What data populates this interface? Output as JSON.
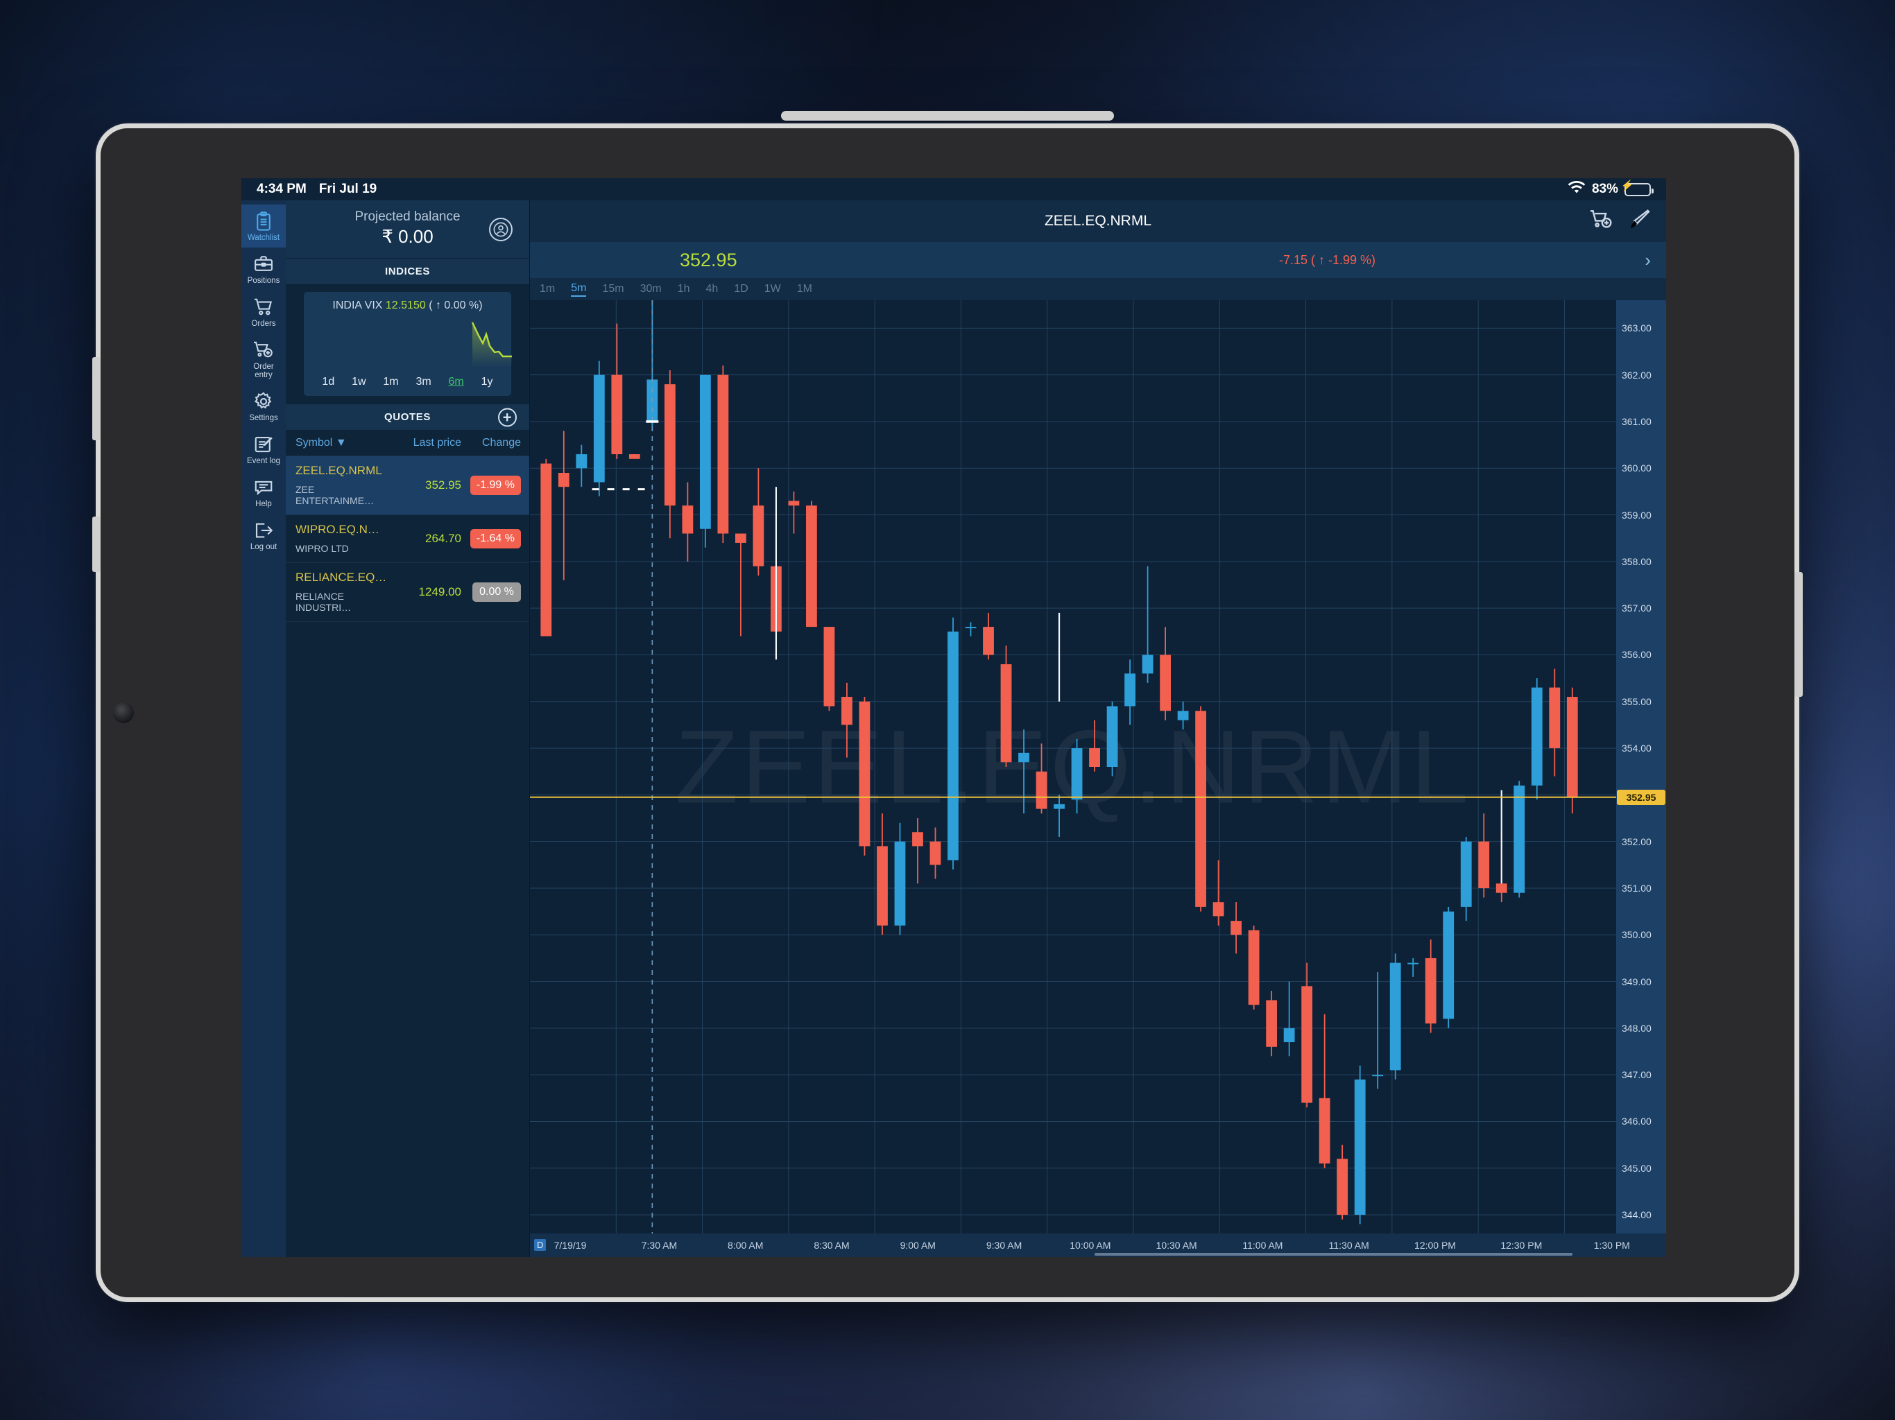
{
  "status_bar": {
    "time": "4:34 PM",
    "date": "Fri Jul 19",
    "battery_percent": "83%",
    "wifi_icon": "wifi-icon",
    "battery_icon": "battery-charging-icon"
  },
  "nav_rail": {
    "items": [
      {
        "label": "Watchlist",
        "icon": "clipboard-icon",
        "active": true
      },
      {
        "label": "Positions",
        "icon": "briefcase-icon",
        "active": false
      },
      {
        "label": "Orders",
        "icon": "cart-icon",
        "active": false
      },
      {
        "label": "Order\nentry",
        "icon": "cart-plus-icon",
        "active": false
      },
      {
        "label": "Settings",
        "icon": "gear-icon",
        "active": false
      },
      {
        "label": "Event log",
        "icon": "note-pencil-icon",
        "active": false
      },
      {
        "label": "Help",
        "icon": "chat-icon",
        "active": false
      },
      {
        "label": "Log out",
        "icon": "logout-icon",
        "active": false
      }
    ]
  },
  "watch_panel": {
    "balance": {
      "label": "Projected balance",
      "value": "₹ 0.00",
      "avatar_icon": "user-circle-icon"
    },
    "indices": {
      "header": "INDICES",
      "name": "INDIA VIX",
      "value": "12.5150",
      "change": "( ↑ 0.00 %)",
      "ranges": [
        "1d",
        "1w",
        "1m",
        "3m",
        "6m",
        "1y"
      ],
      "selected_range": "6m",
      "spark_color": "#b9dd3a"
    },
    "quotes": {
      "header": "QUOTES",
      "add_icon": "plus-circle-icon",
      "columns": {
        "symbol": "Symbol",
        "sort_icon": "▼",
        "last_price": "Last price",
        "change": "Change"
      },
      "rows": [
        {
          "symbol": "ZEEL.EQ.NRML",
          "name": "ZEE ENTERTAINME…",
          "last": "352.95",
          "change": "-1.99 %",
          "change_kind": "neg",
          "selected": true
        },
        {
          "symbol": "WIPRO.EQ.N…",
          "name": "WIPRO LTD",
          "last": "264.70",
          "change": "-1.64 %",
          "change_kind": "neg",
          "selected": false
        },
        {
          "symbol": "RELIANCE.EQ…",
          "name": "RELIANCE INDUSTRI…",
          "last": "1249.00",
          "change": "0.00 %",
          "change_kind": "flat",
          "selected": false
        }
      ]
    }
  },
  "chart_panel": {
    "title": "ZEEL.EQ.NRML",
    "icons": {
      "cart_plus": "cart-plus-icon",
      "brush": "brush-icon",
      "expand_chevron": "›"
    },
    "last_price": "352.95",
    "delta": "-7.15 ( ↑ -1.99 %)",
    "timeframes": [
      "1m",
      "5m",
      "15m",
      "30m",
      "1h",
      "4h",
      "1D",
      "1W",
      "1M"
    ],
    "selected_timeframe": "5m",
    "watermark": "ZEEL.EQ.NRML",
    "date_badge": "D",
    "date_label": "7/19/19",
    "colors": {
      "up": "#2e9fd8",
      "down": "#f2604f",
      "price_line": "#f0c13b",
      "crosshair": "#6f9bbd"
    }
  },
  "chart_data": {
    "type": "candlestick",
    "title": "ZEEL.EQ.NRML",
    "xlabel": "",
    "ylabel": "",
    "ylim": [
      343.6,
      363.6
    ],
    "y_ticks": [
      363.0,
      362.0,
      361.0,
      360.0,
      359.0,
      358.0,
      357.0,
      356.0,
      355.0,
      354.0,
      352.0,
      351.0,
      350.0,
      349.0,
      348.0,
      347.0,
      346.0,
      345.0,
      344.0
    ],
    "current_price": 352.95,
    "current_price_label": "352.95",
    "x_ticks": [
      "7/19/19",
      "7:30 AM",
      "8:00 AM",
      "8:30 AM",
      "9:00 AM",
      "9:30 AM",
      "10:00 AM",
      "10:30 AM",
      "11:00 AM",
      "11:30 AM",
      "12:00 PM",
      "12:30 PM",
      "1:30 PM"
    ],
    "grid": true,
    "candles": [
      {
        "o": 360.1,
        "h": 360.2,
        "l": 356.4,
        "c": 356.4
      },
      {
        "o": 359.9,
        "h": 360.8,
        "l": 357.6,
        "c": 359.6
      },
      {
        "o": 360.0,
        "h": 360.5,
        "l": 359.6,
        "c": 360.3
      },
      {
        "o": 359.7,
        "h": 362.3,
        "l": 359.4,
        "c": 362.0
      },
      {
        "o": 362.0,
        "h": 363.1,
        "l": 360.2,
        "c": 360.3
      },
      {
        "o": 360.3,
        "h": 360.3,
        "l": 360.2,
        "c": 360.2
      },
      {
        "o": 361.0,
        "h": 363.8,
        "l": 360.8,
        "c": 361.9
      },
      {
        "o": 361.8,
        "h": 362.1,
        "l": 358.5,
        "c": 359.2
      },
      {
        "o": 359.2,
        "h": 359.7,
        "l": 358.0,
        "c": 358.6
      },
      {
        "o": 358.7,
        "h": 362.0,
        "l": 358.3,
        "c": 362.0
      },
      {
        "o": 362.0,
        "h": 362.2,
        "l": 358.4,
        "c": 358.6
      },
      {
        "o": 358.6,
        "h": 358.6,
        "l": 356.4,
        "c": 358.4
      },
      {
        "o": 359.2,
        "h": 360.0,
        "l": 357.7,
        "c": 357.9
      },
      {
        "o": 357.9,
        "h": 359.5,
        "l": 356.4,
        "c": 356.5
      },
      {
        "o": 359.3,
        "h": 359.5,
        "l": 358.6,
        "c": 359.2
      },
      {
        "o": 359.2,
        "h": 359.3,
        "l": 356.9,
        "c": 356.6
      },
      {
        "o": 356.6,
        "h": 356.6,
        "l": 354.8,
        "c": 354.9
      },
      {
        "o": 355.1,
        "h": 355.4,
        "l": 353.8,
        "c": 354.5
      },
      {
        "o": 355.0,
        "h": 355.1,
        "l": 351.7,
        "c": 351.9
      },
      {
        "o": 351.9,
        "h": 352.6,
        "l": 350.0,
        "c": 350.2
      },
      {
        "o": 350.2,
        "h": 352.4,
        "l": 350.0,
        "c": 352.0
      },
      {
        "o": 352.2,
        "h": 352.5,
        "l": 351.1,
        "c": 351.9
      },
      {
        "o": 352.0,
        "h": 352.3,
        "l": 351.2,
        "c": 351.5
      },
      {
        "o": 351.6,
        "h": 356.8,
        "l": 351.4,
        "c": 356.5
      },
      {
        "o": 356.6,
        "h": 356.7,
        "l": 356.4,
        "c": 356.6
      },
      {
        "o": 356.6,
        "h": 356.9,
        "l": 355.9,
        "c": 356.0
      },
      {
        "o": 355.8,
        "h": 356.2,
        "l": 353.6,
        "c": 353.7
      },
      {
        "o": 353.7,
        "h": 354.4,
        "l": 352.6,
        "c": 353.9
      },
      {
        "o": 353.5,
        "h": 354.1,
        "l": 352.6,
        "c": 352.7
      },
      {
        "o": 352.7,
        "h": 353.0,
        "l": 352.1,
        "c": 352.8
      },
      {
        "o": 352.9,
        "h": 354.2,
        "l": 352.6,
        "c": 354.0
      },
      {
        "o": 354.0,
        "h": 354.6,
        "l": 353.5,
        "c": 353.6
      },
      {
        "o": 353.6,
        "h": 355.0,
        "l": 353.4,
        "c": 354.9
      },
      {
        "o": 354.9,
        "h": 355.9,
        "l": 354.5,
        "c": 355.6
      },
      {
        "o": 355.6,
        "h": 357.9,
        "l": 355.4,
        "c": 356.0
      },
      {
        "o": 356.0,
        "h": 356.6,
        "l": 354.6,
        "c": 354.8
      },
      {
        "o": 354.6,
        "h": 355.0,
        "l": 354.4,
        "c": 354.8
      },
      {
        "o": 354.8,
        "h": 354.9,
        "l": 350.5,
        "c": 350.6
      },
      {
        "o": 350.7,
        "h": 351.6,
        "l": 350.2,
        "c": 350.4
      },
      {
        "o": 350.3,
        "h": 350.7,
        "l": 349.6,
        "c": 350.0
      },
      {
        "o": 350.1,
        "h": 350.2,
        "l": 348.4,
        "c": 348.5
      },
      {
        "o": 348.6,
        "h": 348.8,
        "l": 347.4,
        "c": 347.6
      },
      {
        "o": 347.7,
        "h": 349.0,
        "l": 347.4,
        "c": 348.0
      },
      {
        "o": 348.9,
        "h": 349.4,
        "l": 346.3,
        "c": 346.4
      },
      {
        "o": 346.5,
        "h": 348.3,
        "l": 345.0,
        "c": 345.1
      },
      {
        "o": 345.2,
        "h": 345.5,
        "l": 343.9,
        "c": 344.0
      },
      {
        "o": 344.0,
        "h": 347.2,
        "l": 343.8,
        "c": 346.9
      },
      {
        "o": 347.0,
        "h": 349.2,
        "l": 346.7,
        "c": 347.0
      },
      {
        "o": 347.1,
        "h": 349.6,
        "l": 346.9,
        "c": 349.4
      },
      {
        "o": 349.4,
        "h": 349.5,
        "l": 349.1,
        "c": 349.4
      },
      {
        "o": 349.5,
        "h": 349.9,
        "l": 347.9,
        "c": 348.1
      },
      {
        "o": 348.2,
        "h": 350.6,
        "l": 348.0,
        "c": 350.5
      },
      {
        "o": 350.6,
        "h": 352.1,
        "l": 350.3,
        "c": 352.0
      },
      {
        "o": 352.0,
        "h": 352.6,
        "l": 350.8,
        "c": 351.0
      },
      {
        "o": 351.1,
        "h": 352.2,
        "l": 350.7,
        "c": 350.9
      },
      {
        "o": 350.9,
        "h": 353.3,
        "l": 350.8,
        "c": 353.2
      },
      {
        "o": 353.2,
        "h": 355.5,
        "l": 352.9,
        "c": 355.3
      },
      {
        "o": 355.3,
        "h": 355.7,
        "l": 353.4,
        "c": 354.0
      },
      {
        "o": 355.1,
        "h": 355.3,
        "l": 352.6,
        "c": 352.95
      }
    ]
  }
}
